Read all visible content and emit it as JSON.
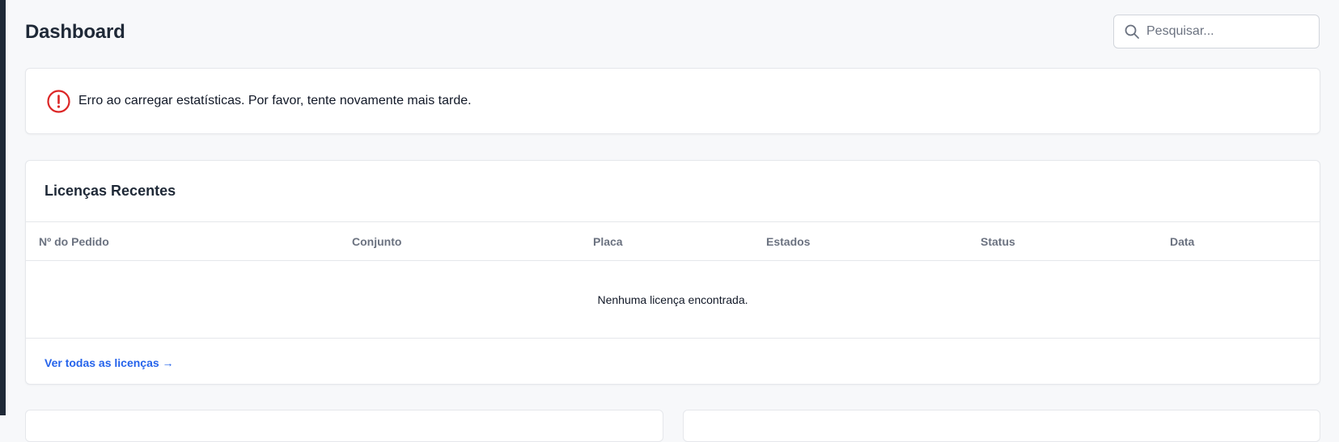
{
  "header": {
    "title": "Dashboard",
    "search_placeholder": "Pesquisar..."
  },
  "alert": {
    "icon": "exclamation-circle-icon",
    "message": "Erro ao carregar estatísticas. Por favor, tente novamente mais tarde.",
    "color": "#dc2626"
  },
  "recent_licenses": {
    "title": "Licenças Recentes",
    "columns": [
      "Nº do Pedido",
      "Conjunto",
      "Placa",
      "Estados",
      "Status",
      "Data"
    ],
    "rows": [],
    "empty_message": "Nenhuma licença encontrada.",
    "view_all_label": "Ver todas as licenças →",
    "link_color": "#2563eb"
  }
}
